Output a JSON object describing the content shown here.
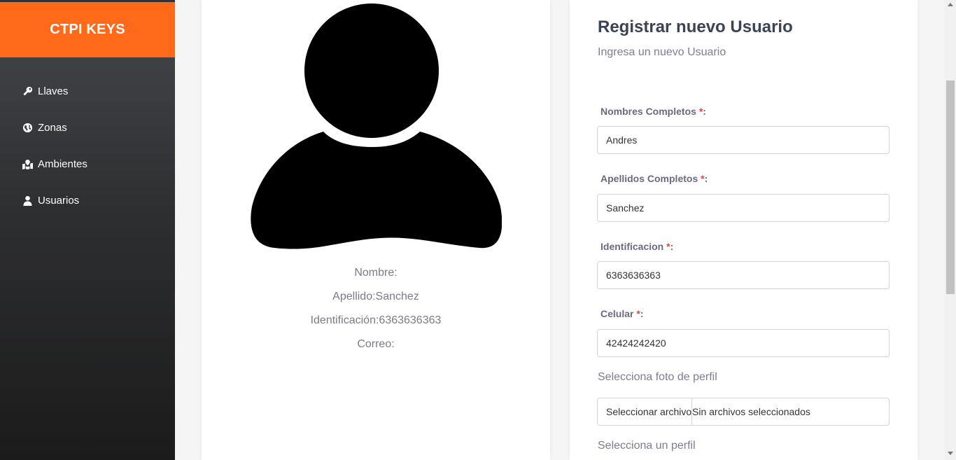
{
  "sidebar": {
    "brand": "CTPI KEYS",
    "items": [
      {
        "label": "Llaves",
        "icon": "key-icon"
      },
      {
        "label": "Zonas",
        "icon": "globe-icon"
      },
      {
        "label": "Ambientes",
        "icon": "map-marker-icon"
      },
      {
        "label": "Usuarios",
        "icon": "user-icon"
      }
    ]
  },
  "profile": {
    "avatar_icon": "user-silhouette-icon",
    "nombre": "Nombre:",
    "apellido": "Apellido:Sanchez",
    "identificacion": "Identificación:6363636363",
    "correo": "Correo:"
  },
  "form": {
    "title": "Registrar nuevo Usuario",
    "subtitle": "Ingresa un nuevo Usuario",
    "required_marker": "*",
    "nombres": {
      "label": "Nombres Completos ",
      "value": "Andres"
    },
    "apellidos": {
      "label": "Apellidos Completos ",
      "value": "Sanchez"
    },
    "identificacion": {
      "label": "Identificacion ",
      "value": "6363636363"
    },
    "celular": {
      "label": "Celular ",
      "value": "42424242420"
    },
    "foto_label": "Selecciona foto de perfil",
    "file_button": "Seleccionar archivo",
    "file_status": "Sin archivos seleccionados",
    "perfil_label": "Selecciona un perfil"
  },
  "colors": {
    "brand": "#ff6a1a",
    "required": "#e0474c"
  }
}
